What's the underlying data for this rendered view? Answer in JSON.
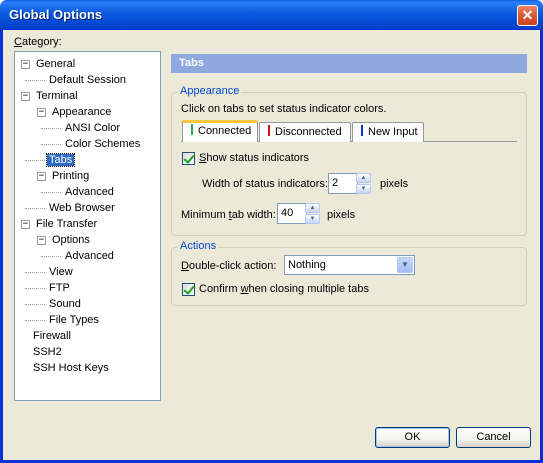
{
  "window": {
    "title": "Global Options",
    "close_glyph": "✕"
  },
  "category": {
    "label": "Category:",
    "tree": [
      {
        "label": "General",
        "expanded": true,
        "level": 0
      },
      {
        "label": "Default Session",
        "level": 1
      },
      {
        "label": "Terminal",
        "expanded": true,
        "level": 0
      },
      {
        "label": "Appearance",
        "expanded": true,
        "level": 1
      },
      {
        "label": "ANSI Color",
        "level": 2
      },
      {
        "label": "Color Schemes",
        "level": 2
      },
      {
        "label": "Tabs",
        "level": 1,
        "selected": true
      },
      {
        "label": "Printing",
        "expanded": true,
        "level": 1
      },
      {
        "label": "Advanced",
        "level": 2
      },
      {
        "label": "Web Browser",
        "level": 1
      },
      {
        "label": "File Transfer",
        "expanded": true,
        "level": 0
      },
      {
        "label": "Options",
        "expanded": true,
        "level": 1
      },
      {
        "label": "Advanced",
        "level": 2
      },
      {
        "label": "View",
        "level": 1
      },
      {
        "label": "FTP",
        "level": 1
      },
      {
        "label": "Sound",
        "level": 1
      },
      {
        "label": "File Types",
        "level": 1
      },
      {
        "label": "Firewall",
        "level": 0
      },
      {
        "label": "SSH2",
        "level": 0
      },
      {
        "label": "SSH Host Keys",
        "level": 0
      }
    ]
  },
  "panel": {
    "title": "Tabs"
  },
  "appearance": {
    "group_title": "Appearance",
    "instructions": "Click on tabs to set status indicator colors.",
    "tabs": [
      {
        "label": "Connected",
        "color": "#22b14c"
      },
      {
        "label": "Disconnected",
        "color": "#d01010"
      },
      {
        "label": "New Input",
        "color": "#1030c8"
      }
    ],
    "show_indicators_label": "Show status indicators",
    "show_indicators_checked": true,
    "width_label": "Width of status indicators:",
    "width_value": "2",
    "width_unit": "pixels",
    "min_width_label": "Minimum tab width:",
    "min_width_value": "40",
    "min_width_unit": "pixels"
  },
  "actions": {
    "group_title": "Actions",
    "double_click_label": "Double-click action:",
    "double_click_value": "Nothing",
    "confirm_label": "Confirm when closing multiple tabs",
    "confirm_checked": true
  },
  "buttons": {
    "ok": "OK",
    "cancel": "Cancel"
  },
  "colors": {
    "title_bar": "#0a5fe0",
    "selection": "#316ac5",
    "group_title": "#0046d5",
    "panel_header": "#8fa8dd"
  }
}
